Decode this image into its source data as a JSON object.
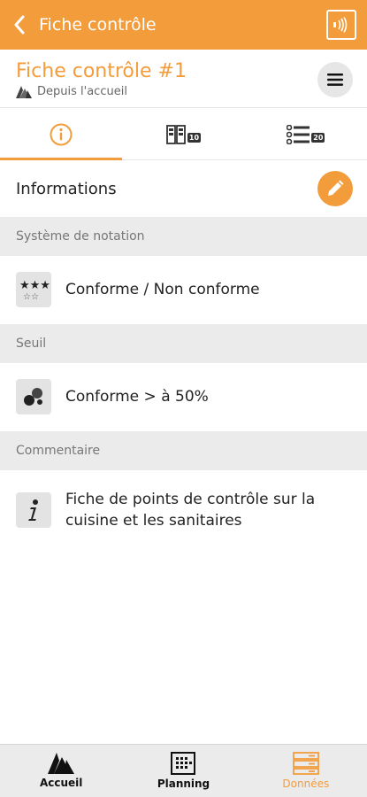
{
  "appbar": {
    "title": "Fiche contrôle"
  },
  "record": {
    "title": "Fiche contrôle #1",
    "subtitle": "Depuis l'accueil"
  },
  "tabs": [
    {
      "name": "info",
      "active": true
    },
    {
      "name": "points",
      "badge": "10"
    },
    {
      "name": "list",
      "badge": "20"
    }
  ],
  "section": {
    "title": "Informations"
  },
  "groups": [
    {
      "label": "Système de notation",
      "value": "Conforme / Non conforme"
    },
    {
      "label": "Seuil",
      "value": "Conforme > à 50%"
    },
    {
      "label": "Commentaire",
      "value": "Fiche de points de contrôle sur la cuisine et les sanitaires"
    }
  ],
  "bottom_nav": [
    {
      "label": "Accueil"
    },
    {
      "label": "Planning"
    },
    {
      "label": "Données",
      "active": true
    }
  ],
  "colors": {
    "accent": "#f39c3c",
    "grey_band": "#ebebeb"
  }
}
